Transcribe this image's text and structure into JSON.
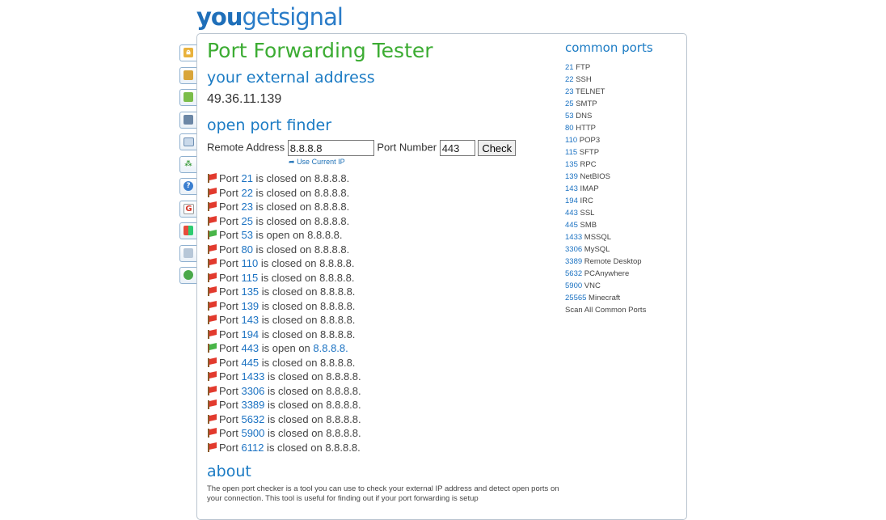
{
  "logo": {
    "you": "you",
    "get": "get",
    "signal": "signal"
  },
  "page_title": "Port Forwarding Tester",
  "external_heading": "your external address",
  "external_ip": "49.36.11.139",
  "finder": {
    "heading": "open port finder",
    "remote_label": "Remote Address",
    "remote_value": "8.8.8.8",
    "port_label": "Port Number",
    "port_value": "443",
    "check_label": "Check",
    "use_current_ip": "Use Current IP"
  },
  "results": [
    {
      "port": "21",
      "status": "closed"
    },
    {
      "port": "22",
      "status": "closed"
    },
    {
      "port": "23",
      "status": "closed"
    },
    {
      "port": "25",
      "status": "closed"
    },
    {
      "port": "53",
      "status": "open"
    },
    {
      "port": "80",
      "status": "closed"
    },
    {
      "port": "110",
      "status": "closed"
    },
    {
      "port": "115",
      "status": "closed"
    },
    {
      "port": "135",
      "status": "closed"
    },
    {
      "port": "139",
      "status": "closed"
    },
    {
      "port": "143",
      "status": "closed"
    },
    {
      "port": "194",
      "status": "closed"
    },
    {
      "port": "443",
      "status": "open"
    },
    {
      "port": "445",
      "status": "closed"
    },
    {
      "port": "1433",
      "status": "closed"
    },
    {
      "port": "3306",
      "status": "closed"
    },
    {
      "port": "3389",
      "status": "closed"
    },
    {
      "port": "5632",
      "status": "closed"
    },
    {
      "port": "5900",
      "status": "closed"
    },
    {
      "port": "6112",
      "status": "closed"
    }
  ],
  "result_text": {
    "port_word": "Port",
    "open_phrase": "is open on",
    "closed_phrase": "is closed on",
    "host": "8.8.8.8."
  },
  "about": {
    "heading": "about",
    "text": "The open port checker is a tool you can use to check your external IP address and detect open ports on your connection. This tool is useful for finding out if your port forwarding is setup"
  },
  "common_ports": {
    "heading": "common ports",
    "items": [
      {
        "port": "21",
        "name": "FTP"
      },
      {
        "port": "22",
        "name": "SSH"
      },
      {
        "port": "23",
        "name": "TELNET"
      },
      {
        "port": "25",
        "name": "SMTP"
      },
      {
        "port": "53",
        "name": "DNS"
      },
      {
        "port": "80",
        "name": "HTTP"
      },
      {
        "port": "110",
        "name": "POP3"
      },
      {
        "port": "115",
        "name": "SFTP"
      },
      {
        "port": "135",
        "name": "RPC"
      },
      {
        "port": "139",
        "name": "NetBIOS"
      },
      {
        "port": "143",
        "name": "IMAP"
      },
      {
        "port": "194",
        "name": "IRC"
      },
      {
        "port": "443",
        "name": "SSL"
      },
      {
        "port": "445",
        "name": "SMB"
      },
      {
        "port": "1433",
        "name": "MSSQL"
      },
      {
        "port": "3306",
        "name": "MySQL"
      },
      {
        "port": "3389",
        "name": "Remote Desktop"
      },
      {
        "port": "5632",
        "name": "PCAnywhere"
      },
      {
        "port": "5900",
        "name": "VNC"
      },
      {
        "port": "25565",
        "name": "Minecraft"
      }
    ],
    "scan_all": "Scan All Common Ports"
  },
  "sidebar_tools": [
    {
      "icon": "lock-icon",
      "active": true
    },
    {
      "icon": "tool-icon"
    },
    {
      "icon": "map-icon"
    },
    {
      "icon": "phone-icon"
    },
    {
      "icon": "email-icon"
    },
    {
      "icon": "network-icon"
    },
    {
      "icon": "help-icon"
    },
    {
      "icon": "google-icon"
    },
    {
      "icon": "windows-icon"
    },
    {
      "icon": "document-icon"
    },
    {
      "icon": "globe-icon"
    }
  ],
  "colors": {
    "brand_blue": "#1f6fb9",
    "title_green": "#3cac33",
    "link_blue": "#1b72c2",
    "flag_closed": "#e23a2e",
    "flag_open": "#48b548"
  }
}
